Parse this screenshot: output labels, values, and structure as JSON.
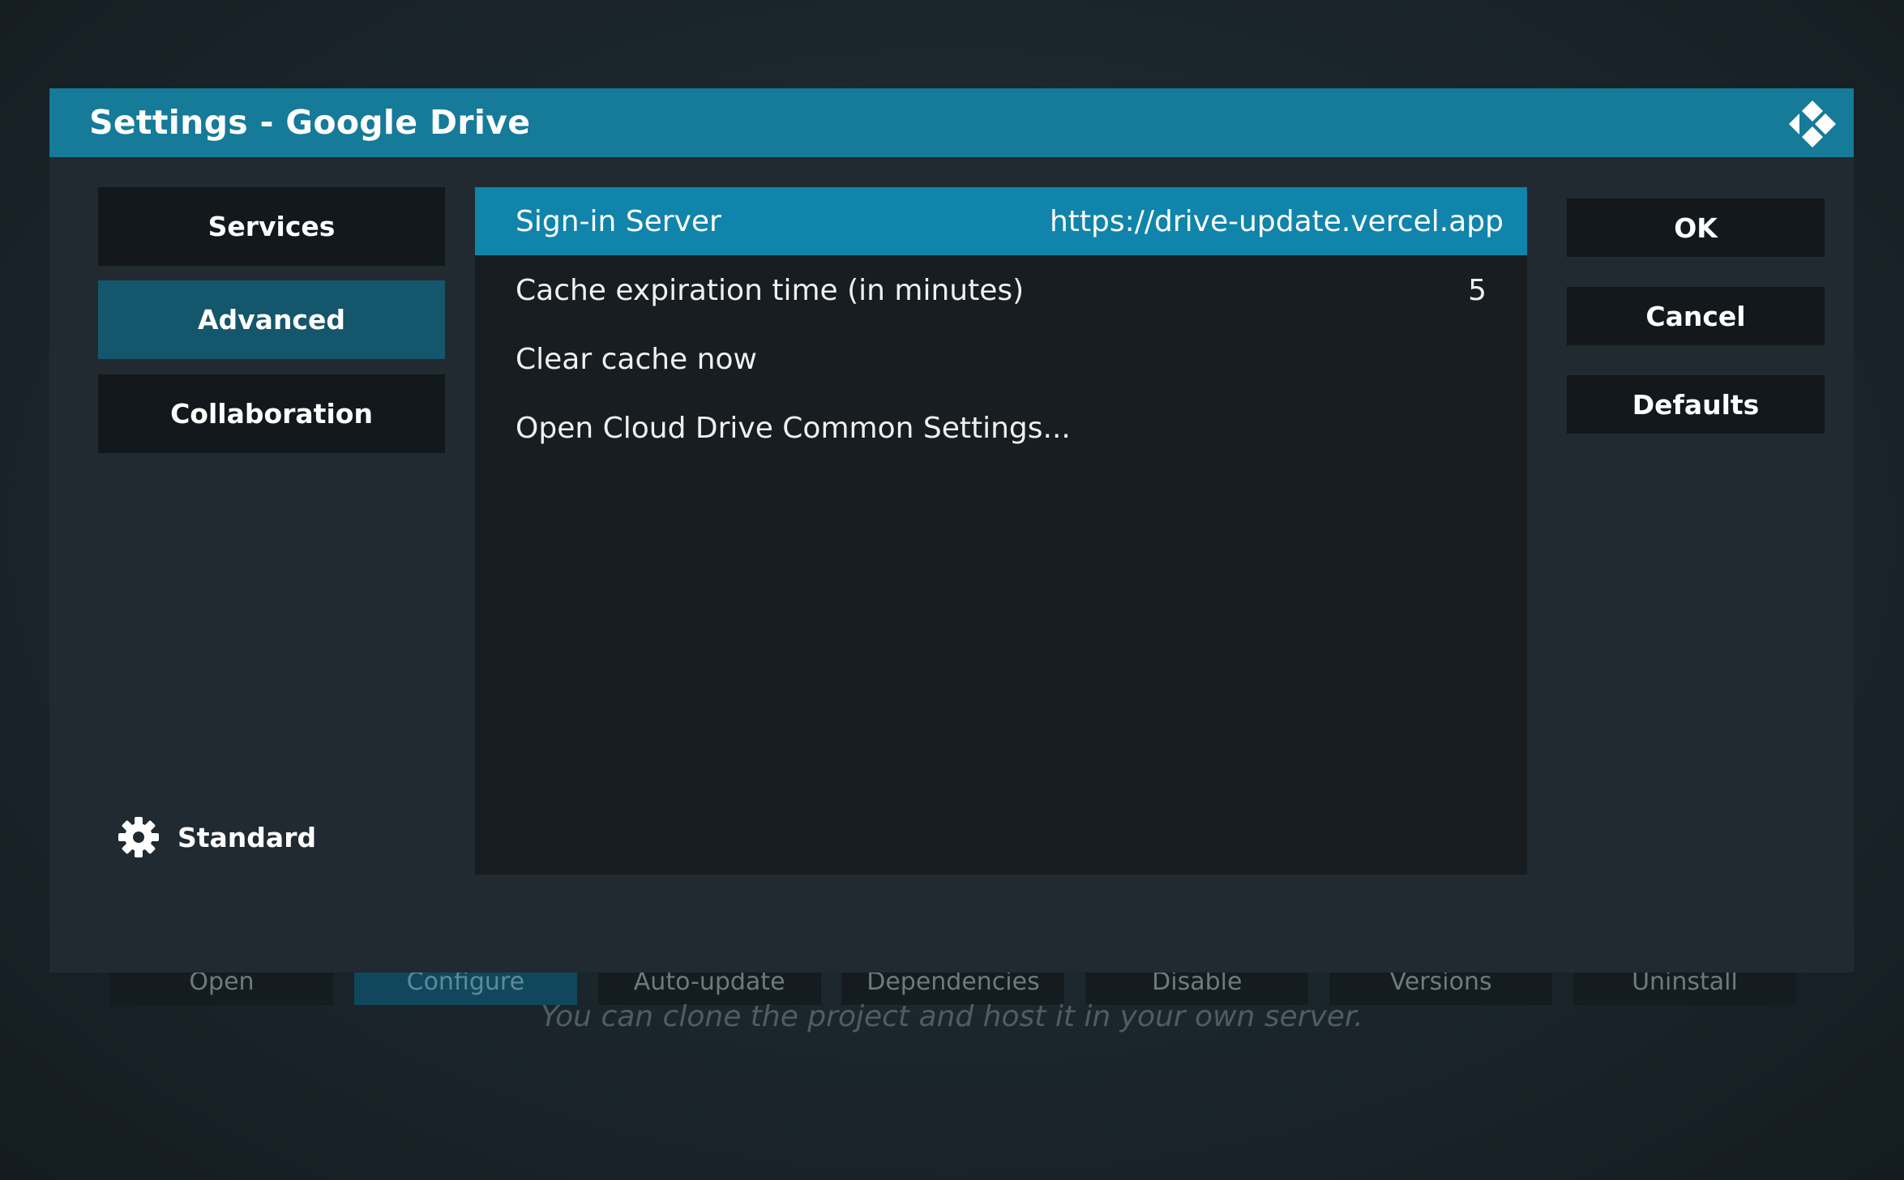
{
  "background": {
    "buttons": [
      {
        "label": "Open"
      },
      {
        "label": "Configure"
      },
      {
        "label": "Auto-update"
      },
      {
        "label": "Dependencies"
      },
      {
        "label": "Disable"
      },
      {
        "label": "Versions"
      },
      {
        "label": "Uninstall"
      }
    ],
    "selected_button": "Configure",
    "description": "You can clone the project and host it in your own server."
  },
  "dialog": {
    "title": "Settings - Google Drive",
    "logo_icon": "kodi-logo-icon",
    "categories": [
      {
        "label": "Services"
      },
      {
        "label": "Advanced"
      },
      {
        "label": "Collaboration"
      }
    ],
    "selected_category": "Advanced",
    "settings_level": {
      "icon": "gear-icon",
      "label": "Standard"
    },
    "settings": [
      {
        "label": "Sign-in Server",
        "value": "https://drive-update.vercel.app"
      },
      {
        "label": "Cache expiration time (in minutes)",
        "value": "5"
      },
      {
        "label": "Clear cache now",
        "value": ""
      },
      {
        "label": "Open Cloud Drive Common Settings...",
        "value": ""
      }
    ],
    "focused_setting": "Sign-in Server",
    "actions": {
      "ok_label": "OK",
      "cancel_label": "Cancel",
      "defaults_label": "Defaults"
    }
  },
  "colors": {
    "titlebar": "#167a99",
    "focused_row": "#1084ab",
    "selected_category": "#14566b",
    "dialog_background": "#202a30",
    "panel_background": "#171d20",
    "button_background": "#12181b"
  }
}
